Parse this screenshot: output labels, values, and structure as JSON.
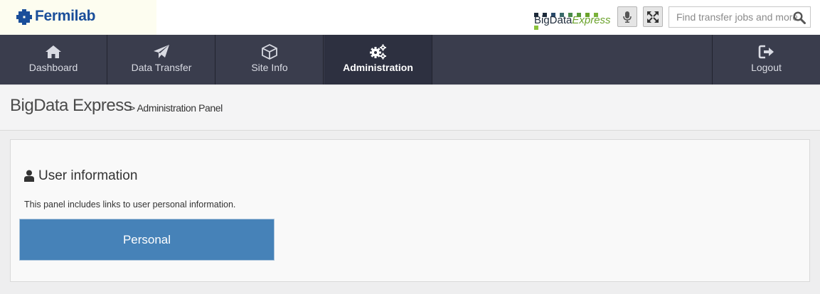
{
  "brand": {
    "name": "Fermilab",
    "color": "#1a4e9a",
    "product_logo": {
      "text_main": "BigData",
      "text_italic": "Express"
    }
  },
  "toolbar": {
    "mic_icon": "microphone-icon",
    "fullscreen_icon": "expand-arrows-icon"
  },
  "search": {
    "placeholder": "Find transfer jobs and more",
    "value": "",
    "icon": "search-icon"
  },
  "nav": {
    "items": [
      {
        "label": "Dashboard",
        "icon": "home-icon"
      },
      {
        "label": "Data Transfer",
        "icon": "paper-plane-icon"
      },
      {
        "label": "Site Info",
        "icon": "cube-icon"
      },
      {
        "label": "Administration",
        "icon": "gears-icon",
        "active": true
      }
    ],
    "logout": {
      "label": "Logout",
      "icon": "sign-out-icon"
    },
    "background": "#3a3d4d"
  },
  "header": {
    "title": "BigData Express",
    "breadcrumb": "> Administration Panel"
  },
  "panel": {
    "heading": "User information",
    "heading_icon": "user-icon",
    "description": "This panel includes links to user personal information.",
    "button_label": "Personal",
    "button_color": "#4682b8"
  }
}
